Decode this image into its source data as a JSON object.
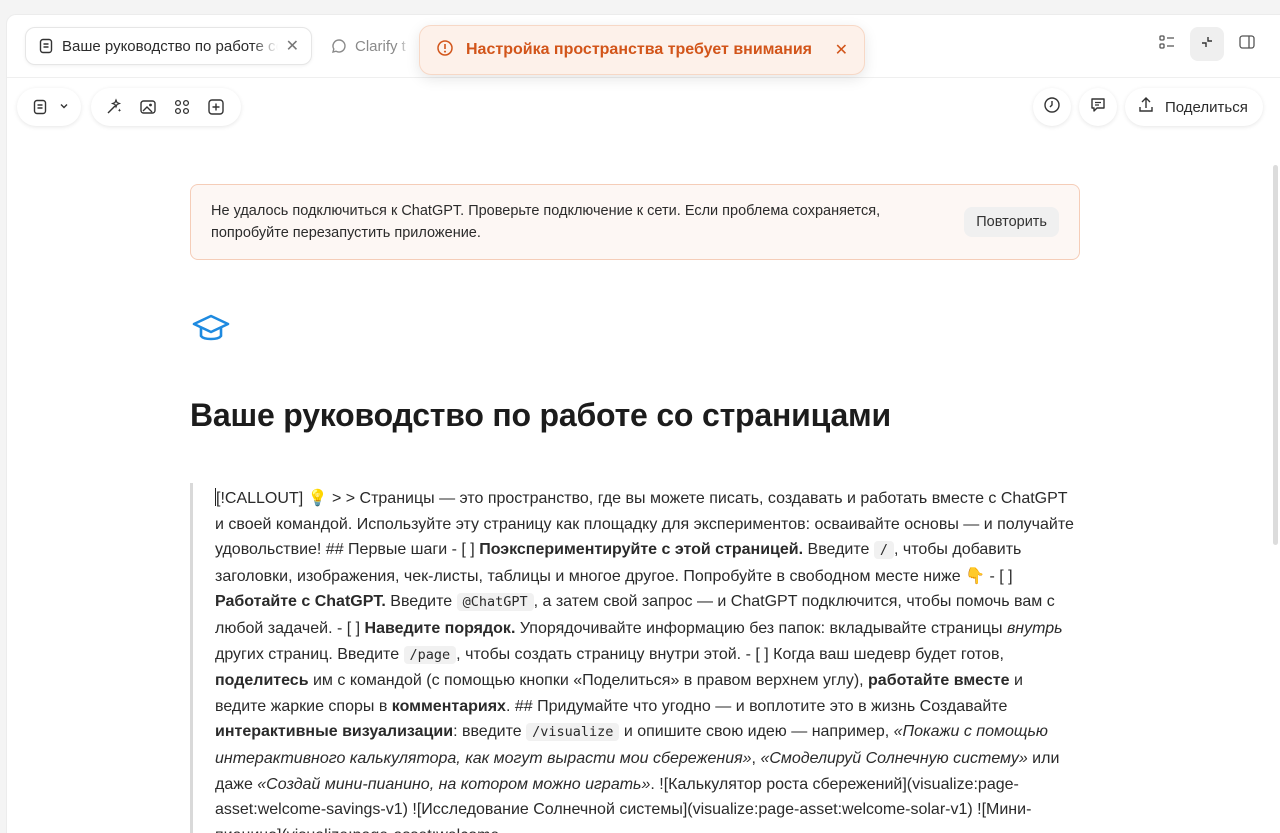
{
  "tabs": [
    {
      "label": "Ваше руководство по работе со страницами",
      "icon": "page-icon",
      "close": "✕"
    },
    {
      "label": "Clarify test",
      "icon": "chat-bubble-icon"
    }
  ],
  "toast": {
    "message": "Настройка пространства требует внимания",
    "close": "✕",
    "color": "#d2551a"
  },
  "toolbar": {
    "share_label": "Поделиться"
  },
  "banner": {
    "message": "Не удалось подключиться к ChatGPT. Проверьте подключение к сети. Если проблема сохраняется, попробуйте перезапустить приложение.",
    "retry_label": "Повторить"
  },
  "page": {
    "title": "Ваше руководство по работе со страницами",
    "icon": "graduation-cap-icon",
    "icon_color": "#1e8ae0",
    "body": [
      {
        "t": "[!CALLOUT] 💡 > > Страницы — это пространство, где вы можете писать, создавать и работать вместе с ChatGPT и своей командой. Используйте эту страницу как площадку для экспериментов: осваивайте основы — и получайте удовольствие! ## Первые шаги - [ ] "
      },
      {
        "t": "Поэкспериментируйте с этой страницей.",
        "s": "b"
      },
      {
        "t": " Введите "
      },
      {
        "t": "/",
        "s": "code"
      },
      {
        "t": ", чтобы добавить заголовки, изображения, чек-листы, таблицы и многое другое. Попробуйте в свободном месте ниже 👇 - [ ] "
      },
      {
        "t": "Работайте с ChatGPT.",
        "s": "b"
      },
      {
        "t": " Введите "
      },
      {
        "t": "@ChatGPT",
        "s": "code"
      },
      {
        "t": ", а затем свой запрос — и ChatGPT подключится, чтобы помочь вам с любой задачей. - [ ] "
      },
      {
        "t": "Наведите порядок.",
        "s": "b"
      },
      {
        "t": " Упорядочивайте информацию без папок: вкладывайте страницы "
      },
      {
        "t": "внутрь",
        "s": "i"
      },
      {
        "t": " других страниц. Введите "
      },
      {
        "t": "/page",
        "s": "code"
      },
      {
        "t": ", чтобы создать страницу внутри этой. - [ ] Когда ваш шедевр будет готов, "
      },
      {
        "t": "поделитесь",
        "s": "b"
      },
      {
        "t": " им с командой (с помощью кнопки «Поделиться» в правом верхнем углу), "
      },
      {
        "t": "работайте вместе",
        "s": "b"
      },
      {
        "t": " и ведите жаркие споры в "
      },
      {
        "t": "комментариях",
        "s": "b"
      },
      {
        "t": ". ## Придумайте что угодно — и воплотите это в жизнь Создавайте "
      },
      {
        "t": "интерактивные визуализации",
        "s": "b"
      },
      {
        "t": ": введите "
      },
      {
        "t": "/visualize",
        "s": "code"
      },
      {
        "t": " и опишите свою идею — например, "
      },
      {
        "t": "«Покажи с помощью интерактивного калькулятора, как могут вырасти мои сбережения»",
        "s": "i"
      },
      {
        "t": ", "
      },
      {
        "t": "«Смоделируй Солнечную систему»",
        "s": "i"
      },
      {
        "t": " или даже "
      },
      {
        "t": "«Создай мини-пианино, на котором можно играть»",
        "s": "i"
      },
      {
        "t": ". ![Калькулятор роста сбережений](visualize:page-asset:welcome-savings-v1) ![Исследование Солнечной системы](visualize:page-asset:welcome-solar-v1) ![Мини-пианино](visualize:page-asset:welcome-"
      }
    ]
  }
}
